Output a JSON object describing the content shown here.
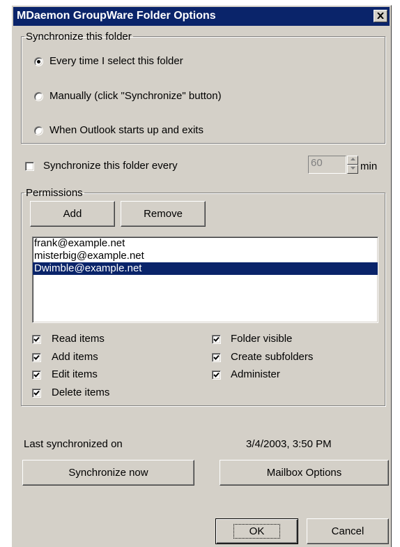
{
  "window": {
    "title": "MDaemon GroupWare Folder Options",
    "close_glyph": "✕"
  },
  "sync_group": {
    "label": "Synchronize this folder",
    "options": [
      {
        "label": "Every time I select this folder",
        "selected": true
      },
      {
        "label": "Manually (click \"Synchronize\" button)",
        "selected": false
      },
      {
        "label": "When Outlook starts up and exits",
        "selected": false
      }
    ]
  },
  "periodic": {
    "label": "Synchronize this folder every",
    "checked": false,
    "interval_value": "60",
    "unit": "min"
  },
  "permissions": {
    "label": "Permissions",
    "add_label": "Add",
    "remove_label": "Remove",
    "users": [
      "frank@example.net",
      "misterbig@example.net",
      "Dwimble@example.net"
    ],
    "selected_user": "Dwimble@example.net",
    "rights_left": [
      {
        "label": "Read items",
        "checked": true
      },
      {
        "label": "Add items",
        "checked": true
      },
      {
        "label": "Edit items",
        "checked": true
      },
      {
        "label": "Delete items",
        "checked": true
      }
    ],
    "rights_right": [
      {
        "label": "Folder visible",
        "checked": true
      },
      {
        "label": "Create subfolders",
        "checked": true
      },
      {
        "label": "Administer",
        "checked": true
      }
    ]
  },
  "last_sync": {
    "label": "Last synchronized on",
    "value": "3/4/2003, 3:50 PM"
  },
  "actions": {
    "sync_now_label": "Synchronize now",
    "mailbox_options_label": "Mailbox Options"
  },
  "footer": {
    "ok_label": "OK",
    "cancel_label": "Cancel"
  },
  "colors": {
    "title_bar": "#0a246a",
    "face": "#d4d0c8",
    "selection": "#0a246a"
  },
  "icons": {
    "close": "close-icon",
    "radio": "radio-dot",
    "check": "checkmark-icon",
    "spin_up": "arrow-up-icon",
    "spin_down": "arrow-down-icon"
  }
}
